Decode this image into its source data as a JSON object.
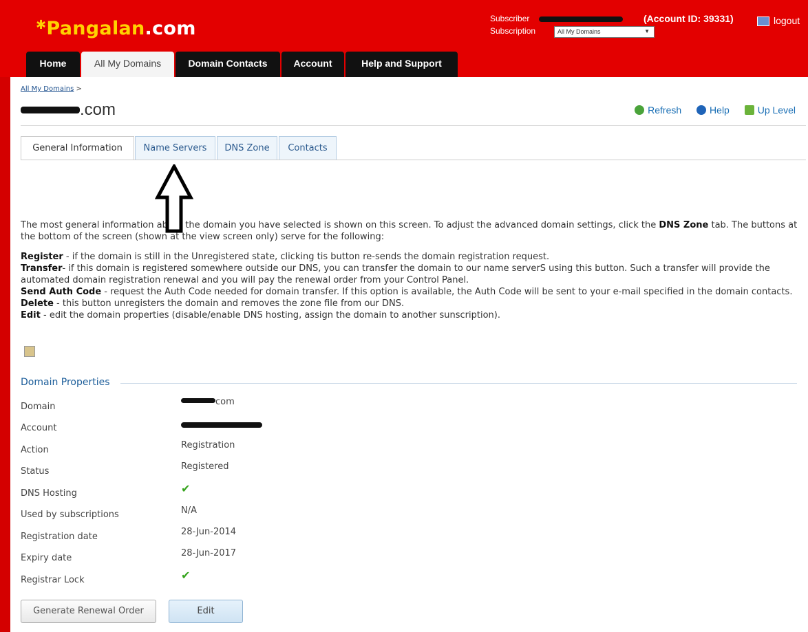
{
  "header": {
    "logo": {
      "main": "Pangalan",
      "tld": ".com"
    },
    "subscriber_label": "Subscriber",
    "subscription_label": "Subscription",
    "account_id": "(Account ID: 39331)",
    "subscription_select": "All My Domains",
    "logout": "logout"
  },
  "nav": {
    "tabs": [
      {
        "label": "Home"
      },
      {
        "label": "All My Domains"
      },
      {
        "label": "Domain Contacts"
      },
      {
        "label": "Account"
      },
      {
        "label": "Help and Support"
      }
    ]
  },
  "breadcrumb": {
    "link": "All My Domains",
    "sep": ">"
  },
  "page": {
    "title_suffix": ".com"
  },
  "tools": {
    "refresh": "Refresh",
    "help": "Help",
    "up": "Up Level"
  },
  "page_tabs": [
    {
      "label": "General Information"
    },
    {
      "label": "Name Servers"
    },
    {
      "label": "DNS Zone"
    },
    {
      "label": "Contacts"
    }
  ],
  "desc": {
    "intro_a": "The most general information about the domain you have selected is shown on this screen. To adjust the advanced domain settings, click the ",
    "intro_b": "DNS Zone",
    "intro_c": " tab. The buttons at the bottom of the screen (shown at the view screen only) serve for the following:",
    "register_b": "Register",
    "register_t": " - if the domain is still in the Unregistered state, clicking tis button re-sends the domain registration request.",
    "transfer_b": "Transfer",
    "transfer_t": "- if this domain is registered somewhere outside our DNS, you can transfer the domain to our name serverS using this button. Such a transfer will provide the automated domain registration renewal and you will pay the renewal order from your Control Panel.",
    "auth_b": "Send Auth Code",
    "auth_t": " - request the Auth Code needed for domain transfer. If this option is available, the Auth Code will be sent to your e-mail specified in the domain contacts.",
    "delete_b": "Delete",
    "delete_t": " - this button unregisters the domain and removes the zone file from our DNS.",
    "edit_b": "Edit",
    "edit_t": " - edit the domain properties (disable/enable DNS hosting, assign the domain to another sunscription)."
  },
  "props": {
    "heading": "Domain Properties",
    "rows": [
      {
        "label": "Domain",
        "value": "com"
      },
      {
        "label": "Account",
        "value": ""
      },
      {
        "label": "Action",
        "value": "Registration"
      },
      {
        "label": "Status",
        "value": "Registered"
      },
      {
        "label": "DNS Hosting",
        "value": "✔"
      },
      {
        "label": "Used by subscriptions",
        "value": "N/A"
      },
      {
        "label": "Registration date",
        "value": "28-Jun-2014"
      },
      {
        "label": "Expiry date",
        "value": "28-Jun-2017"
      },
      {
        "label": "Registrar Lock",
        "value": "✔"
      }
    ]
  },
  "buttons": {
    "renewal": "Generate Renewal Order",
    "edit": "Edit"
  },
  "colors": {
    "header_red": "#e30000",
    "nav_black": "#111111",
    "link_blue": "#1a6fb5",
    "check_green": "#36a41d"
  }
}
